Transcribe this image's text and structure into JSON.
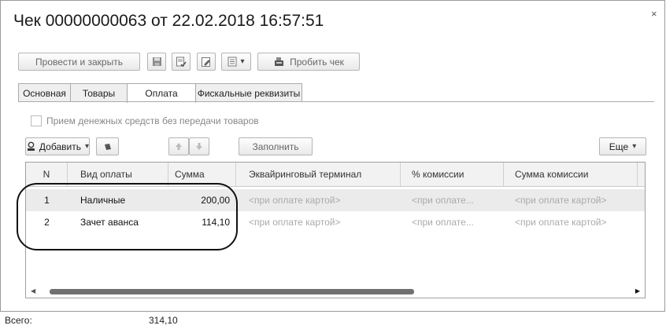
{
  "window": {
    "title": "Чек 00000000063 от 22.02.2018 16:57:51",
    "close_glyph": "×"
  },
  "toolbar": {
    "post_close_label": "Провести и закрыть",
    "print_receipt_label": "Пробить чек",
    "dropdown_glyph": "▾"
  },
  "tabs": [
    {
      "label": "Основная",
      "active": false
    },
    {
      "label": "Товары",
      "active": false
    },
    {
      "label": "Оплата",
      "active": true
    },
    {
      "label": "Фискальные реквизиты",
      "active": false
    }
  ],
  "checkbox": {
    "label": "Прием денежных средств без передачи товаров",
    "checked": false
  },
  "table_toolbar": {
    "add_label": "Добавить",
    "fill_label": "Заполнить",
    "more_label": "Еще"
  },
  "table": {
    "columns": [
      "N",
      "Вид оплаты",
      "Сумма",
      "Эквайринговый терминал",
      "% комиссии",
      "Сумма комиссии"
    ],
    "rows": [
      {
        "n": "1",
        "type": "Наличные",
        "sum": "200,00",
        "terminal": "<при оплате картой>",
        "commission_pct": "<при оплате...",
        "commission_sum": "<при оплате картой>"
      },
      {
        "n": "2",
        "type": "Зачет аванса",
        "sum": "114,10",
        "terminal": "<при оплате картой>",
        "commission_pct": "<при оплате...",
        "commission_sum": "<при оплате картой>"
      }
    ]
  },
  "footer": {
    "total_label": "Всего:",
    "total_value": "314,10"
  },
  "colors": {
    "selected_row": "#ebebeb",
    "header_bg": "#f2f2f2",
    "border": "#a0a0a0"
  }
}
